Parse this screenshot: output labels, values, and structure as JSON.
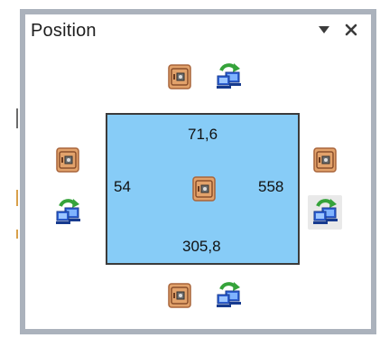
{
  "panel": {
    "title": "Position",
    "menu_icon": "dropdown-triangle-icon",
    "close_icon": "close-icon"
  },
  "position": {
    "top": "71,6",
    "left": "54",
    "right": "558",
    "bottom": "305,8"
  },
  "icons": {
    "align": "safe-icon",
    "stretch": "network-computers-icon"
  },
  "colors": {
    "rect_fill": "#87ccf7",
    "rect_border": "#3b3b3b",
    "panel_border": "#abb2bc",
    "safe_body": "#e2a26b",
    "safe_dial": "#6e6e6e",
    "computer_blue": "#2f61d4",
    "arrow_green": "#35a33a"
  }
}
